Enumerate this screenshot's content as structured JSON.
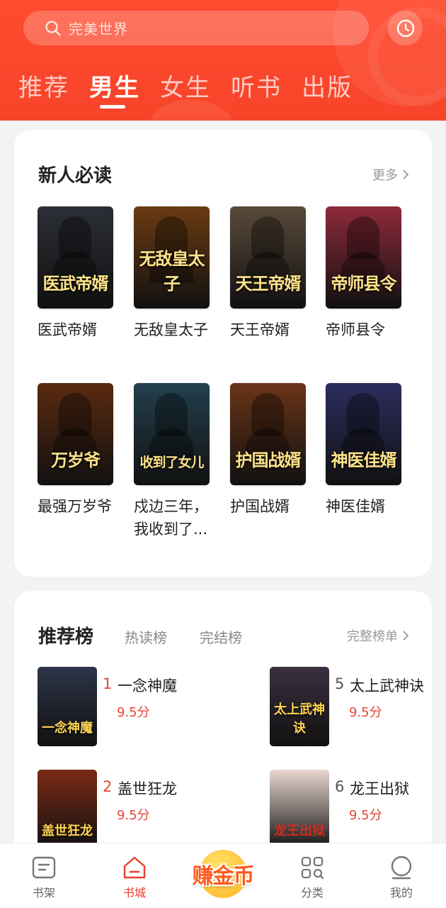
{
  "search": {
    "placeholder": "完美世界"
  },
  "tabs": [
    {
      "label": "推荐",
      "active": false
    },
    {
      "label": "男生",
      "active": true
    },
    {
      "label": "女生",
      "active": false
    },
    {
      "label": "听书",
      "active": false
    },
    {
      "label": "出版",
      "active": false
    }
  ],
  "new_reads": {
    "title": "新人必读",
    "more_label": "更多",
    "books": [
      {
        "name": "医武帝婿",
        "cover_text": "医武帝婿",
        "color": "#2b2e35"
      },
      {
        "name": "无敌皇太子",
        "cover_text": "无敌皇太子",
        "color": "#6b3b12"
      },
      {
        "name": "天王帝婿",
        "cover_text": "天王帝婿",
        "color": "#5a4a3a"
      },
      {
        "name": "帝师县令",
        "cover_text": "帝师县令",
        "color": "#8e2a3a"
      },
      {
        "name": "最强万岁爷",
        "cover_text": "万岁爷",
        "color": "#5a2a10"
      },
      {
        "name": "戍边三年，我收到了...",
        "cover_text": "收到了女儿",
        "color": "#23404e"
      },
      {
        "name": "护国战婿",
        "cover_text": "护国战婿",
        "color": "#6a3418"
      },
      {
        "name": "神医佳婿",
        "cover_text": "神医佳婿",
        "color": "#2c2d5e"
      }
    ]
  },
  "ranking": {
    "title": "推荐榜",
    "tabs": [
      "热读榜",
      "完结榜"
    ],
    "full_label": "完整榜单",
    "items": [
      {
        "rank": "1",
        "name": "一念神魔",
        "score": "9.5分",
        "cover_text": "一念神魔",
        "color": "#2d3448"
      },
      {
        "rank": "5",
        "name": "太上武神诀",
        "score": "9.5分",
        "cover_text": "太上武神诀",
        "color": "#3a3040"
      },
      {
        "rank": "2",
        "name": "盖世狂龙",
        "score": "9.5分",
        "cover_text": "盖世狂龙",
        "color": "#7a2a14"
      },
      {
        "rank": "6",
        "name": "龙王出狱",
        "score": "9.5分",
        "cover_text": "龙王出狱",
        "color": "#e9d8d0"
      }
    ]
  },
  "bottom_nav": [
    {
      "label": "书架",
      "icon": "bookshelf-icon",
      "active": false
    },
    {
      "label": "书城",
      "icon": "bookstore-icon",
      "active": true
    },
    {
      "label": "赚金币",
      "icon": "earn-coins-icon",
      "active": false
    },
    {
      "label": "分类",
      "icon": "category-icon",
      "active": false
    },
    {
      "label": "我的",
      "icon": "profile-icon",
      "active": false
    }
  ],
  "colors": {
    "brand": "#f7442a",
    "accent_red": "#e8453a"
  }
}
